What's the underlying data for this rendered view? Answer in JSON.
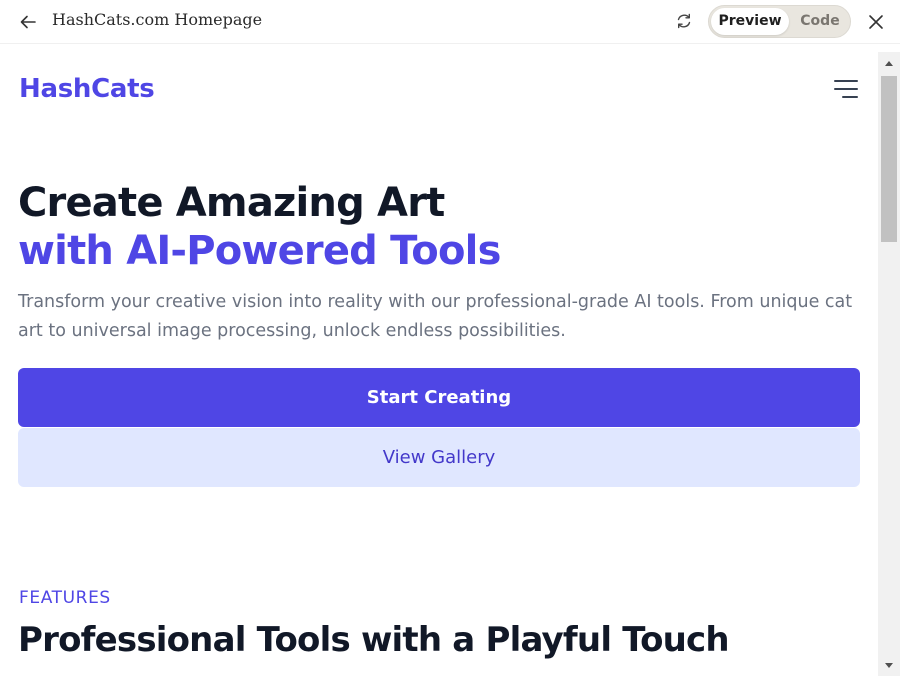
{
  "window": {
    "title": "HashCats.com Homepage",
    "toggle": {
      "preview_label": "Preview",
      "code_label": "Code",
      "active": "Preview"
    },
    "icons": {
      "back": "arrow-left-icon",
      "refresh": "refresh-icon",
      "close": "close-icon"
    }
  },
  "site": {
    "logo": "HashCats",
    "menu_icon": "hamburger-menu-icon"
  },
  "hero": {
    "headline_line1": "Create Amazing Art",
    "headline_line2": "with AI-Powered Tools",
    "description": "Transform your creative vision into reality with our professional-grade AI tools. From unique cat art to universal image processing, unlock endless possibilities.",
    "primary_button": "Start Creating",
    "secondary_button": "View Gallery"
  },
  "features": {
    "eyebrow": "FEATURES",
    "title": "Professional Tools with a Playful Touch"
  },
  "colors": {
    "brand": "#4f46e5",
    "brand_light": "#e0e7ff",
    "heading": "#111827",
    "body_text": "#6b7280"
  }
}
